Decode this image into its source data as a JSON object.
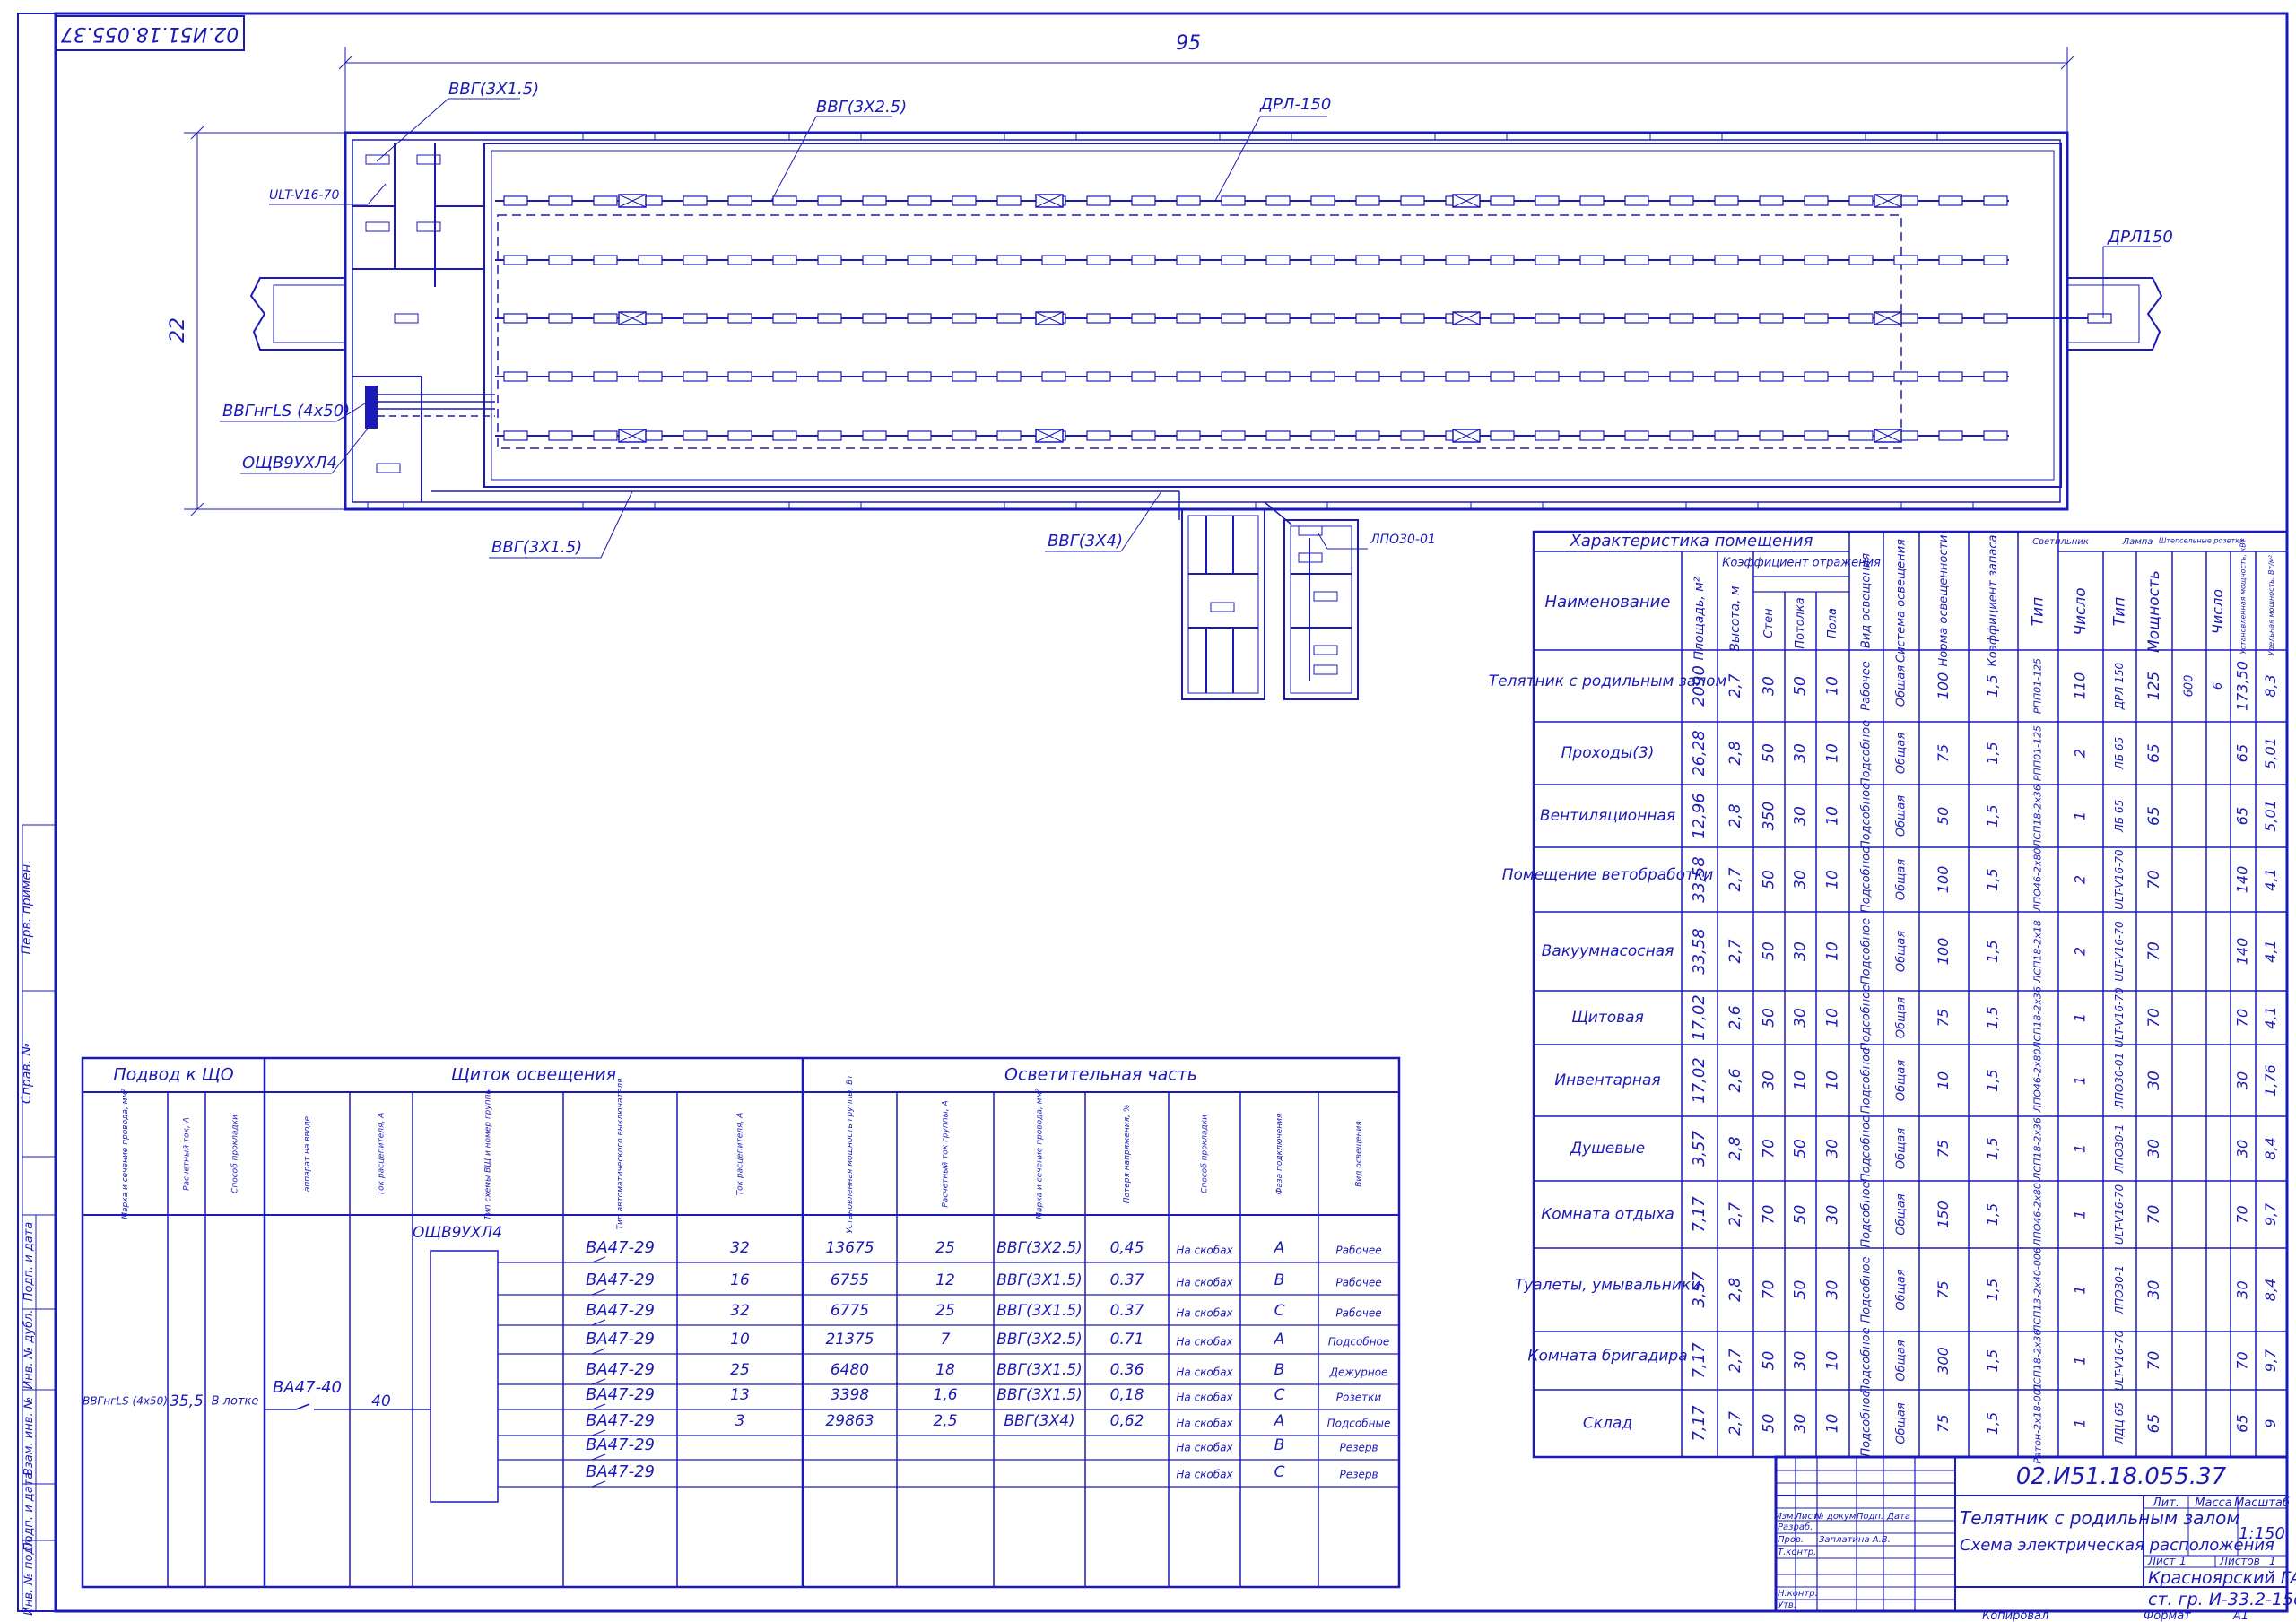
{
  "stamp_code_rotated": "02.И51.18.055.37",
  "plan": {
    "dim_length": "95",
    "dim_width": "22",
    "labels": {
      "cable_vvg_3x15_top": "ВВГ(3Х1.5)",
      "cable_vvg_3x25": "ВВГ(3Х2.5)",
      "lamp_drl150": "ДРЛ-150",
      "lamp_ult": "ULT-V16-70",
      "lamp_drl150_right": "ДРЛ150",
      "cable_input": "ВВГнгLS (4х50)",
      "panel": "ОЩВ9УХЛ4",
      "cable_vvg_3x15_bottom": "ВВГ(3Х1.5)",
      "cable_vvg_3x4": "ВВГ(3Х4)",
      "lamp_lpo": "ЛПО30-01"
    }
  },
  "panel_table": {
    "section_headers": [
      "Подвод к ЩО",
      "Щиток освещения",
      "Осветительная часть"
    ],
    "column_headers": [
      "Марка и сечение провода, мм²",
      "Расчетный ток, А",
      "Способ прокладки",
      "аппарат на вводе",
      "Ток расцепителя, А",
      "Тип схемы ВЩ и номер группы",
      "Тип автоматического выключателя",
      "Ток расцепителя, А",
      "Установленная мощность группы, Вт",
      "Расчетный ток группы, А",
      "Марка и сечение провода, мм²",
      "Потеря напряжения, %",
      "Способ прокладки",
      "Фаза подключения",
      "Вид освещения"
    ],
    "feed": {
      "cable": "ВВГнгLS (4х50)",
      "current": "35,5",
      "method": "В лотке",
      "breaker": "ВА47-40",
      "trip": "40",
      "panel": "ОЩВ9УХЛ4"
    },
    "groups": [
      {
        "breaker": "ВА47-29",
        "trip": "32",
        "power": "13675",
        "current": "25",
        "cable": "ВВГ(3Х2.5)",
        "loss": "0,45",
        "method": "На скобах",
        "phase": "А",
        "kind": "Рабочее"
      },
      {
        "breaker": "ВА47-29",
        "trip": "16",
        "power": "6755",
        "current": "12",
        "cable": "ВВГ(3Х1.5)",
        "loss": "0.37",
        "method": "На скобах",
        "phase": "В",
        "kind": "Рабочее"
      },
      {
        "breaker": "ВА47-29",
        "trip": "32",
        "power": "6775",
        "current": "25",
        "cable": "ВВГ(3Х1.5)",
        "loss": "0.37",
        "method": "На скобах",
        "phase": "С",
        "kind": "Рабочее"
      },
      {
        "breaker": "ВА47-29",
        "trip": "10",
        "power": "21375",
        "current": "7",
        "cable": "ВВГ(3Х2.5)",
        "loss": "0.71",
        "method": "На скобах",
        "phase": "А",
        "kind": "Подсобное"
      },
      {
        "breaker": "ВА47-29",
        "trip": "25",
        "power": "6480",
        "current": "18",
        "cable": "ВВГ(3Х1.5)",
        "loss": "0.36",
        "method": "На скобах",
        "phase": "В",
        "kind": "Дежурное"
      },
      {
        "breaker": "ВА47-29",
        "trip": "13",
        "power": "3398",
        "current": "1,6",
        "cable": "ВВГ(3Х1.5)",
        "loss": "0,18",
        "method": "На скобах",
        "phase": "С",
        "kind": "Розетки"
      },
      {
        "breaker": "ВА47-29",
        "trip": "3",
        "power": "29863",
        "current": "2,5",
        "cable": "ВВГ(3Х4)",
        "loss": "0,62",
        "method": "На скобах",
        "phase": "А",
        "kind": "Подсобные"
      },
      {
        "breaker": "ВА47-29",
        "trip": "",
        "power": "",
        "current": "",
        "cable": "",
        "loss": "",
        "method": "На скобах",
        "phase": "В",
        "kind": "Резерв"
      },
      {
        "breaker": "ВА47-29",
        "trip": "",
        "power": "",
        "current": "",
        "cable": "",
        "loss": "",
        "method": "На скобах",
        "phase": "С",
        "kind": "Резерв"
      }
    ]
  },
  "room_table": {
    "title": "Характеристика помещения",
    "headers": {
      "name": "Наименование",
      "area": "Площадь, м²",
      "height": "Высота, м",
      "refl_group": "Коэффициент отражения",
      "walls": "Стен",
      "ceiling": "Потолка",
      "floor": "Пола",
      "light_kind": "Вид освещения",
      "system": "Система освещения",
      "norm": "Норма освещенности",
      "reserve": "Коэффициент запаса",
      "fixture": "Светильник",
      "fixture_type": "Тип",
      "fixture_count": "Число",
      "lamp": "Лампа",
      "lamp_type": "Тип",
      "lamp_power": "Мощность",
      "socket": "Штепсельные розетки",
      "socket_count": "Число",
      "installed": "Установленная мощность, кВт",
      "specific": "Удельная мощность, Вт/м²"
    },
    "rows": [
      {
        "name": "Телятник с родильным залом",
        "area": "2090",
        "height": "2,7",
        "walls": "30",
        "ceiling": "50",
        "floor": "10",
        "kind": "Рабочее",
        "system": "Общая",
        "norm": "100",
        "reserve": "1,5",
        "ftype": "РПП01-125",
        "fcount": "110",
        "ltype": "ДРЛ 150",
        "lpower": "125",
        "socket": "600",
        "scount": "6",
        "installed": "173,50",
        "specific": "8,3"
      },
      {
        "name": "Проходы(3)",
        "area": "26,28",
        "height": "2,8",
        "walls": "50",
        "ceiling": "30",
        "floor": "10",
        "kind": "Подсобное",
        "system": "Общая",
        "norm": "75",
        "reserve": "1,5",
        "ftype": "РПП01-125",
        "fcount": "2",
        "ltype": "ЛБ 65",
        "lpower": "65",
        "socket": "",
        "scount": "",
        "installed": "65",
        "specific": "5,01"
      },
      {
        "name": "Вентиляционная",
        "area": "12,96",
        "height": "2,8",
        "walls": "350",
        "ceiling": "30",
        "floor": "10",
        "kind": "Подсобное",
        "system": "Общая",
        "norm": "50",
        "reserve": "1,5",
        "ftype": "ЛСП18-2х36",
        "fcount": "1",
        "ltype": "ЛБ 65",
        "lpower": "65",
        "socket": "",
        "scount": "",
        "installed": "65",
        "specific": "5,01"
      },
      {
        "name": "Помещение ветобработки",
        "area": "33,58",
        "height": "2,7",
        "walls": "50",
        "ceiling": "30",
        "floor": "10",
        "kind": "Подсобное",
        "system": "Общая",
        "norm": "100",
        "reserve": "1,5",
        "ftype": "ЛПО46-2х80",
        "fcount": "2",
        "ltype": "ULT-V16-70",
        "lpower": "70",
        "socket": "",
        "scount": "",
        "installed": "140",
        "specific": "4,1"
      },
      {
        "name": "Вакуумнасосная",
        "area": "33,58",
        "height": "2,7",
        "walls": "50",
        "ceiling": "30",
        "floor": "10",
        "kind": "Подсобное",
        "system": "Общая",
        "norm": "100",
        "reserve": "1,5",
        "ftype": "ЛСП18-2х18",
        "fcount": "2",
        "ltype": "ULT-V16-70",
        "lpower": "70",
        "socket": "",
        "scount": "",
        "installed": "140",
        "specific": "4,1"
      },
      {
        "name": "Щитовая",
        "area": "17,02",
        "height": "2,6",
        "walls": "50",
        "ceiling": "30",
        "floor": "10",
        "kind": "Подсобное",
        "system": "Общая",
        "norm": "75",
        "reserve": "1,5",
        "ftype": "ЛСП18-2х36",
        "fcount": "1",
        "ltype": "ULT-V16-70",
        "lpower": "70",
        "socket": "",
        "scount": "",
        "installed": "70",
        "specific": "4,1"
      },
      {
        "name": "Инвентарная",
        "area": "17,02",
        "height": "2,6",
        "walls": "30",
        "ceiling": "10",
        "floor": "10",
        "kind": "Подсобное",
        "system": "Общая",
        "norm": "10",
        "reserve": "1,5",
        "ftype": "ЛПО46-2х80",
        "fcount": "1",
        "ltype": "ЛПО30-01",
        "lpower": "30",
        "socket": "",
        "scount": "",
        "installed": "30",
        "specific": "1,76"
      },
      {
        "name": "Душевые",
        "area": "3,57",
        "height": "2,8",
        "walls": "70",
        "ceiling": "50",
        "floor": "30",
        "kind": "Подсобное",
        "system": "Общая",
        "norm": "75",
        "reserve": "1,5",
        "ftype": "ЛСП18-2х36",
        "fcount": "1",
        "ltype": "ЛПО30-1",
        "lpower": "30",
        "socket": "",
        "scount": "",
        "installed": "30",
        "specific": "8,4"
      },
      {
        "name": "Комната отдыха",
        "area": "7,17",
        "height": "2,7",
        "walls": "70",
        "ceiling": "50",
        "floor": "30",
        "kind": "Подсобное",
        "system": "Общая",
        "norm": "150",
        "reserve": "1,5",
        "ftype": "ЛПО46-2х80",
        "fcount": "1",
        "ltype": "ULT-V16-70",
        "lpower": "70",
        "socket": "",
        "scount": "",
        "installed": "70",
        "specific": "9,7"
      },
      {
        "name": "Туалеты, умывальники",
        "area": "3,57",
        "height": "2,8",
        "walls": "70",
        "ceiling": "50",
        "floor": "30",
        "kind": "Подсобное",
        "system": "Общая",
        "norm": "75",
        "reserve": "1,5",
        "ftype": "ЛСП13-2х40-006",
        "fcount": "1",
        "ltype": "ЛПО30-1",
        "lpower": "30",
        "socket": "",
        "scount": "",
        "installed": "30",
        "specific": "8,4"
      },
      {
        "name": "Комната бригадира",
        "area": "7,17",
        "height": "2,7",
        "walls": "50",
        "ceiling": "30",
        "floor": "10",
        "kind": "Подсобное",
        "system": "Общая",
        "norm": "300",
        "reserve": "1,5",
        "ftype": "ЛСП18-2х36",
        "fcount": "1",
        "ltype": "ULT-V16-70",
        "lpower": "70",
        "socket": "",
        "scount": "",
        "installed": "70",
        "specific": "9,7"
      },
      {
        "name": "Склад",
        "area": "7,17",
        "height": "2,7",
        "walls": "50",
        "ceiling": "30",
        "floor": "10",
        "kind": "Подсобное",
        "system": "Общая",
        "norm": "75",
        "reserve": "1,5",
        "ftype": "Ратон-2х18-001",
        "fcount": "1",
        "ltype": "ЛДЦ 65",
        "lpower": "65",
        "socket": "",
        "scount": "",
        "installed": "65",
        "specific": "9"
      }
    ]
  },
  "title_block": {
    "code": "02.И51.18.055.37",
    "title1": "Телятник с родильным залом",
    "title2": "Схема электрическая расположения",
    "col_izm": "Изм.",
    "col_list": "Лист",
    "col_doc": "№ докум.",
    "col_sign": "Подп.",
    "col_date": "Дата",
    "r_razrab": "Разраб.",
    "r_prov": "Пров.",
    "r_tkontr": "Т.контр.",
    "r_nkontr": "Н.контр.",
    "r_utv": "Утв.",
    "checker": "Заплатина А.В.",
    "lit": "Лит.",
    "massa": "Масса",
    "masshtab": "Масштаб",
    "scale": "1:150",
    "sheet": "Лист",
    "sheet_no": "1",
    "sheets": "Листов",
    "sheets_no": "1",
    "org1": "Красноярский ГАУ",
    "org2": "ст. гр. И-33.2-15о",
    "copied": "Копировал",
    "format": "Формат",
    "format_val": "А1"
  },
  "side_stamp": {
    "labels": [
      "Перв. примен.",
      "Справ. №",
      "Подп. и дата",
      "Инв. № дубл.",
      "Взам. инв. №",
      "Подп. и дата",
      "Инв. № подл."
    ]
  }
}
